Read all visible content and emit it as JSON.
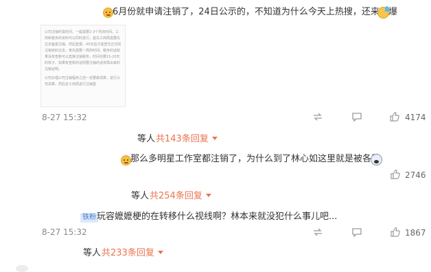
{
  "comments": [
    {
      "text": "6月份就申请注销了，24日公示的，不知道为什么今天上热搜，还来个爆",
      "image_doc": {
        "paragraphs": [
          "公司注销时需时间，一般需要2-3个月的时间。工商和税务的资料可以同时进行，首先工商局需要先过去备案注销。然后登报，45天后才能登交正式的注销资料过去。率先需要一周的时间。税务的话如果没有查账可以直接注销税务，时间也要15-20天的样子。如果有查账的话则要注销的话将再出来的注销证明。",
          "公司办理公司注销程序之前一定要做清算，进行公司清算。然后去工商局进行注销登"
        ]
      },
      "time": "8-27 15:32",
      "likes": "4174",
      "reply_prefix": "等人",
      "reply_link": "共143条回复"
    },
    {
      "text": "那么多明星工作室都注销了，为什么到了林心如这里就是被各种",
      "time": "",
      "likes": "2746",
      "reply_prefix": "等人",
      "reply_link": "共254条回复"
    },
    {
      "badge": "铁粉",
      "text": "玩容嬷嬷梗的在转移什么视线啊？林本来就没犯什么事儿吧...",
      "time": "8-27 15:32",
      "likes": "1867",
      "reply_prefix": "等人",
      "reply_link": "共233条回复"
    }
  ],
  "icons": {
    "like": "thumbs-up-icon",
    "comment": "comment-bubble-icon",
    "repost": "repost-icon",
    "emoji_laugh": "laughing-face-emoji",
    "emoji_sweat": "sweat-face-emoji",
    "emoji_shock": "shocked-face-emoji"
  },
  "colors": {
    "link_orange": "#eb7350",
    "meta_gray": "#888888",
    "badge_bg": "#dce9fb",
    "badge_text": "#4a7bd0"
  }
}
